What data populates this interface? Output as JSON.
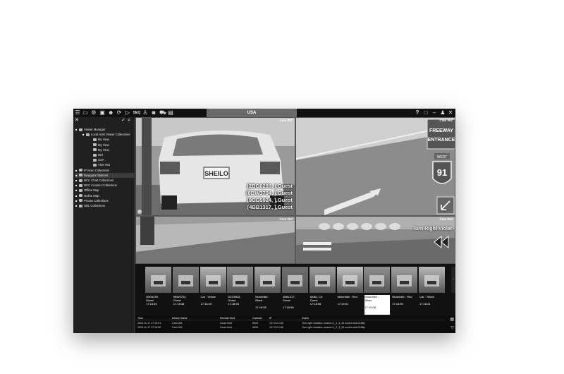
{
  "window": {
    "tab_label": "USA",
    "seq_label": "SEQ"
  },
  "toolbar_icons": [
    "menu-icon",
    "monitor-icon",
    "gear-icon",
    "video-icon",
    "user-icon",
    "refresh-icon",
    "play-icon",
    "seq-icon",
    "person-icon",
    "camera-icon",
    "car-icon",
    "database-icon"
  ],
  "top_right_icons": [
    "help-icon",
    "restore-icon",
    "minimize-icon",
    "user-icon",
    "close-icon"
  ],
  "sidebar": {
    "tree": [
      {
        "label": "Viewer Manager",
        "level": 0
      },
      {
        "label": "Local Host Viewer Collections",
        "level": 1
      },
      {
        "label": "My View",
        "level": 2
      },
      {
        "label": "My View",
        "level": 2
      },
      {
        "label": "My View",
        "level": 2
      },
      {
        "label": "NHI",
        "level": 2
      },
      {
        "label": "USA",
        "level": 2
      },
      {
        "label": "View #01",
        "level": 2
      },
      {
        "label": "IP Scan Collections",
        "level": 0
      },
      {
        "label": "Navigator Stations",
        "level": 0,
        "highlight": true
      },
      {
        "label": "NCC Chart Collections",
        "level": 0
      },
      {
        "label": "NCC Counter Collections",
        "level": 0
      },
      {
        "label": "Offline Map",
        "level": 0
      },
      {
        "label": "Online Map",
        "level": 0
      },
      {
        "label": "Private Collections",
        "level": 0
      },
      {
        "label": "URL Collections",
        "level": 0
      }
    ]
  },
  "cameras": [
    {
      "label": "Cam 001",
      "plates": [
        "[2BG6299, ],Guest",
        "[8BW3704, ],Guest",
        "[9CG5924, ],Guest",
        "[4BB1317, ],Guest"
      ],
      "plate_text": "SHEILO"
    },
    {
      "label": "Cam 002",
      "signs": [
        "FREEWAY",
        "ENTRANCE",
        "WEST",
        "91"
      ]
    },
    {
      "label": "Cam 003"
    },
    {
      "label": "Cam 004",
      "overlay": "Turn Right Violat"
    }
  ],
  "thumbnails": [
    {
      "lines": [
        "2BG6299,",
        "Guest",
        "17:18:45"
      ]
    },
    {
      "lines": [
        "8BW3704,",
        "Guest",
        "17:18:46"
      ]
    },
    {
      "lines": [
        "Car : Yellow",
        "",
        "17:18:49"
      ]
    },
    {
      "lines": [
        "9CG5924,",
        "Guest",
        "17:18:53"
      ]
    },
    {
      "lines": [
        "Motorbike :",
        "Black",
        "",
        "17:18:55"
      ]
    },
    {
      "lines": [
        "4BB1317,",
        "Guest",
        "",
        "17:18:58"
      ]
    },
    {
      "lines": [
        "6AB6, CA",
        "Guest",
        "17:18:58"
      ]
    },
    {
      "lines": [
        "Motorbike : Red",
        "",
        "17:19:01"
      ]
    },
    {
      "lines": [
        "Motorbike :",
        "Silver",
        "",
        "17:19:06"
      ],
      "selected": true
    },
    {
      "lines": [
        "Motorbike : Red",
        "",
        "17:18:35"
      ]
    },
    {
      "lines": [
        "Car : Yellow",
        "",
        "17:18:41"
      ]
    }
  ],
  "events": {
    "headers": {
      "time": "Time",
      "device": "Device Name",
      "remote": "Remote Host",
      "channel": "Channel",
      "ip": "IP",
      "guest": "Guest"
    },
    "rows": [
      {
        "time": "2020-11-17 17:19:01",
        "device": "Cam 004",
        "remote": "Local Host",
        "channel": "#004",
        "ip": "127.0.0.1:80",
        "guest": "Turn right violation: sname=1_2_3_34 sculor=sid=0188p"
      },
      {
        "time": "2020-11-17 17:19:06",
        "device": "Cam 004",
        "remote": "Local Host",
        "channel": "#004",
        "ip": "127.0.0.1:80",
        "guest": "Turn right violation: sname=1_2_3_34 sculor=sid=0188p"
      }
    ]
  }
}
